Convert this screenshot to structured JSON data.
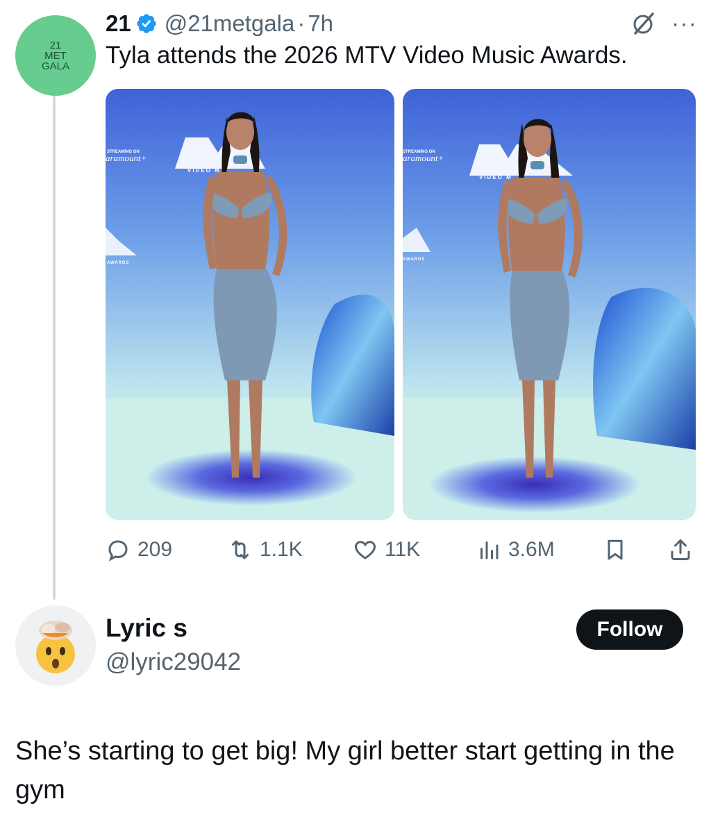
{
  "tweet": {
    "avatar_lines": [
      "21",
      "MET",
      "GALA"
    ],
    "display_name": "21",
    "handle": "@21metgala",
    "separator": "·",
    "time": "7h",
    "text": "Tyla attends the 2026 MTV Video Music Awards.",
    "more_label": "···",
    "images": [
      {
        "alt_subject": "Tyla on VMA carpet, left photo"
      },
      {
        "alt_subject": "Tyla on VMA carpet, right photo"
      }
    ],
    "backdrop_text": {
      "streaming_on": "STREAMING ON",
      "brand": "aramount+",
      "video_label": "VIDEO M",
      "awards_label": "AWARDS"
    }
  },
  "actions": {
    "replies": "209",
    "reposts": "1.1K",
    "likes": "11K",
    "views": "3.6M"
  },
  "reply": {
    "display_name": "Lyric s",
    "handle": "@lyric29042",
    "follow_label": "Follow",
    "text": "She’s starting to get big! My girl better start getting in the gym"
  },
  "colors": {
    "text_primary": "#0f1419",
    "text_secondary": "#536471",
    "verified_blue": "#1d9bf0",
    "avatar_green": "#66cc8f",
    "thread_line": "#cfd9de",
    "follow_bg": "#0f1419"
  },
  "icons": {
    "verified": "verified-badge-icon",
    "grok": "grok-slash-icon",
    "reply": "reply-bubble-icon",
    "repost": "repost-icon",
    "like": "heart-icon",
    "views": "views-bars-icon",
    "bookmark": "bookmark-icon",
    "share": "share-icon"
  }
}
